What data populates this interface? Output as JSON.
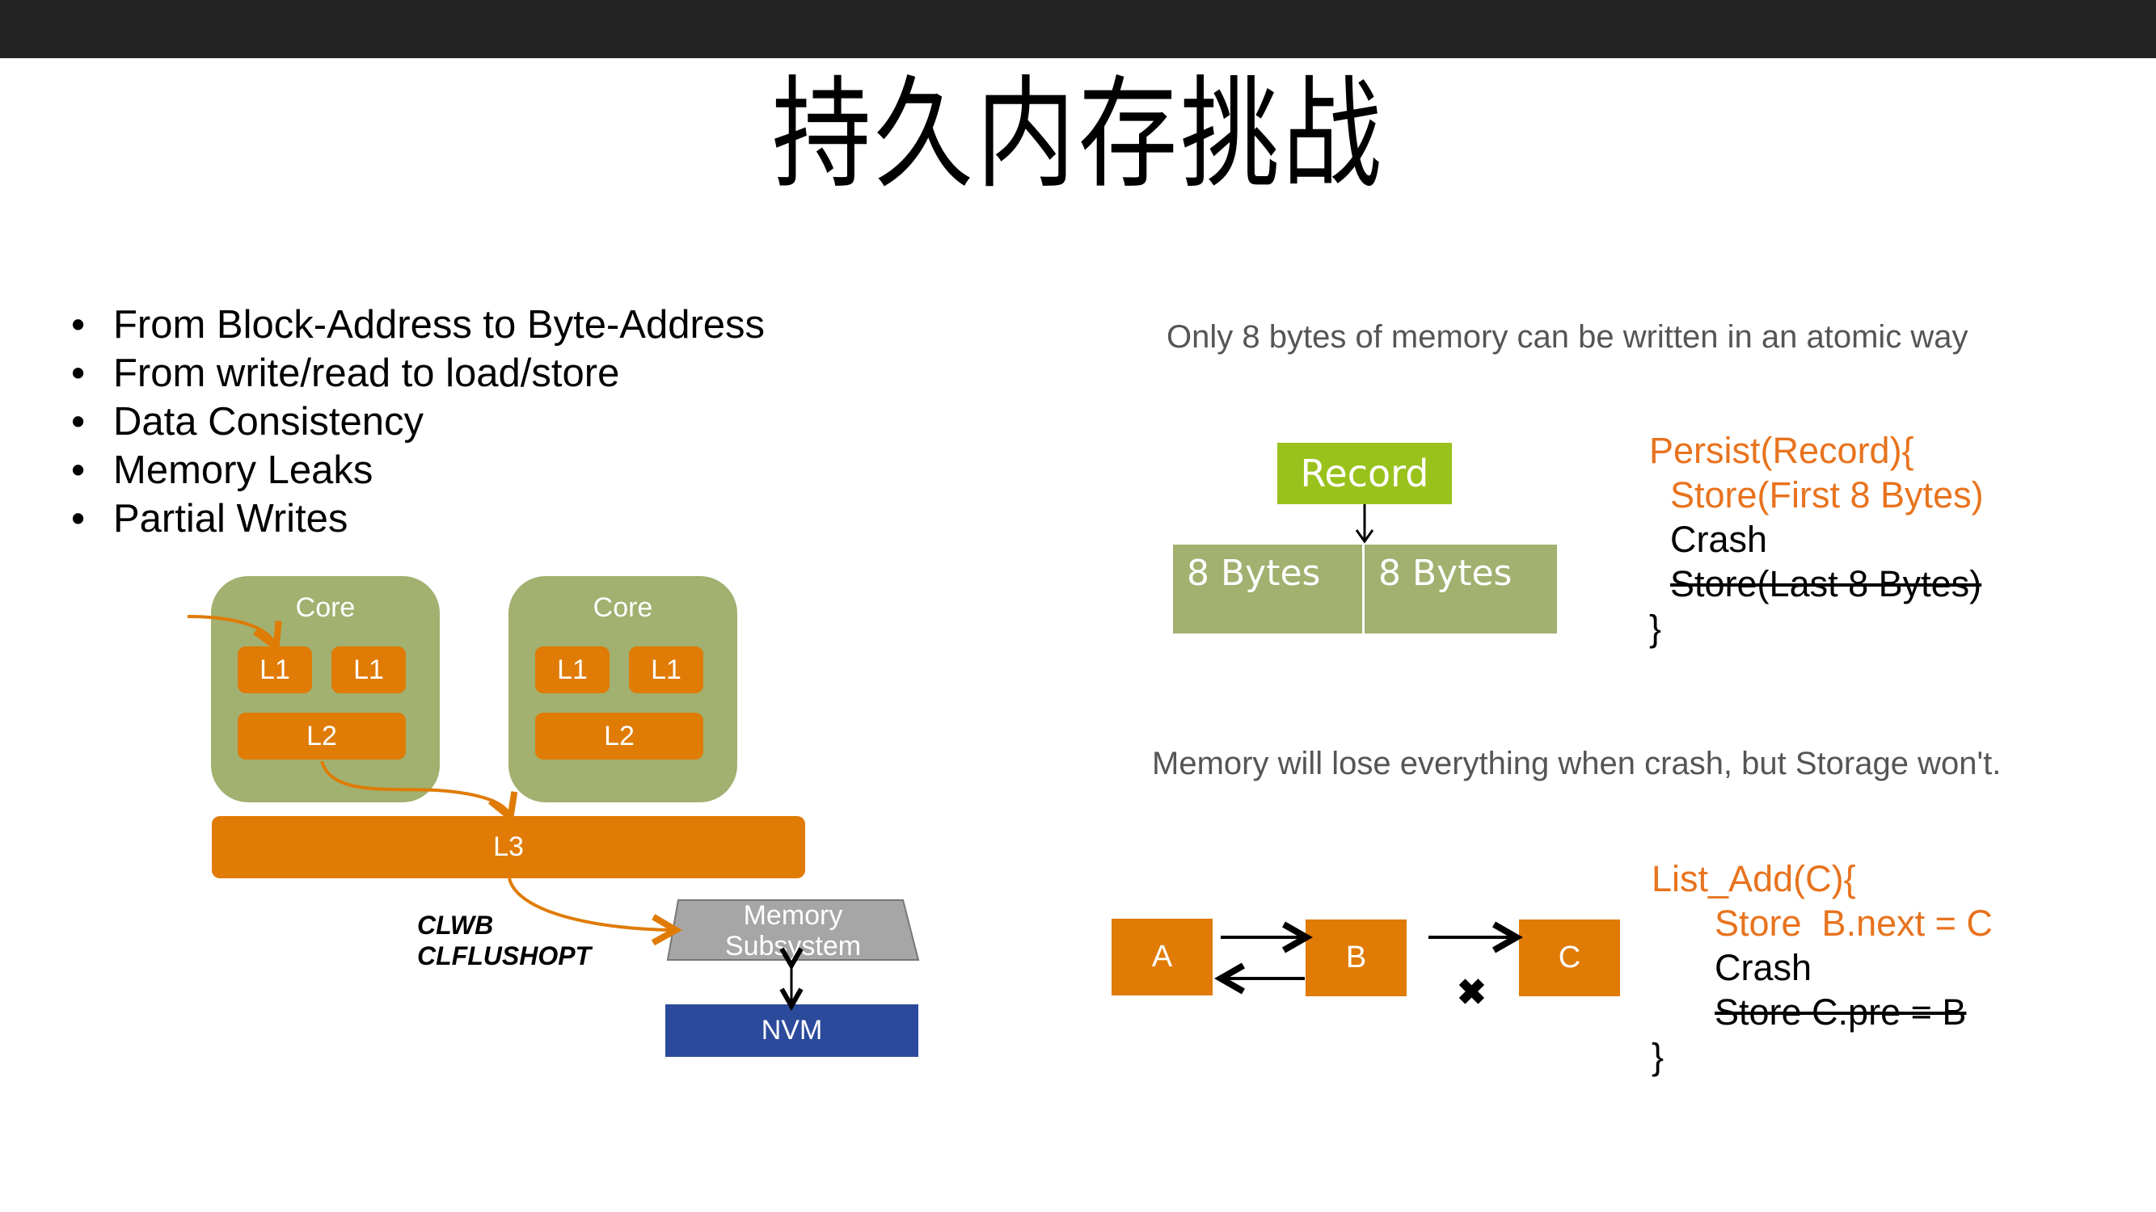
{
  "slide": {
    "title": "持久内存挑战",
    "bullets": [
      "From Block-Address to Byte-Address",
      "From write/read to load/store",
      "Data Consistency",
      "Memory Leaks",
      "Partial Writes"
    ]
  },
  "cache_diagram": {
    "cores": [
      {
        "label": "Core",
        "l1": [
          "L1",
          "L1"
        ],
        "l2": "L2"
      },
      {
        "label": "Core",
        "l1": [
          "L1",
          "L1"
        ],
        "l2": "L2"
      }
    ],
    "l3": "L3",
    "instructions": [
      "CLWB",
      "CLFLUSHOPT"
    ],
    "memory_subsystem": [
      "Memory",
      "Subsystem"
    ],
    "nvm": "NVM"
  },
  "atomic_section": {
    "note": "Only 8 bytes of memory can be written in an atomic way",
    "record": "Record",
    "bytes": [
      "8 Bytes",
      "8 Bytes"
    ],
    "code": {
      "line1": "Persist(Record){",
      "line2": "Store(First 8 Bytes)",
      "line3": "Crash",
      "line4": "Store(Last 8 Bytes)",
      "line5": "}"
    }
  },
  "crash_section": {
    "note": "Memory will lose everything when crash,  but Storage won't.",
    "nodes": [
      "A",
      "B",
      "C"
    ],
    "code": {
      "line1": "List_Add(C){",
      "line2": "Store  B.next = C",
      "line3": "Crash",
      "line4": "Store C.pre = B",
      "line5": "}"
    }
  },
  "colors": {
    "orange": "#e07b05",
    "olive": "#a2b070",
    "lime": "#99c21c",
    "navy": "#2b4a9b",
    "gray": "#a6a6a6"
  }
}
